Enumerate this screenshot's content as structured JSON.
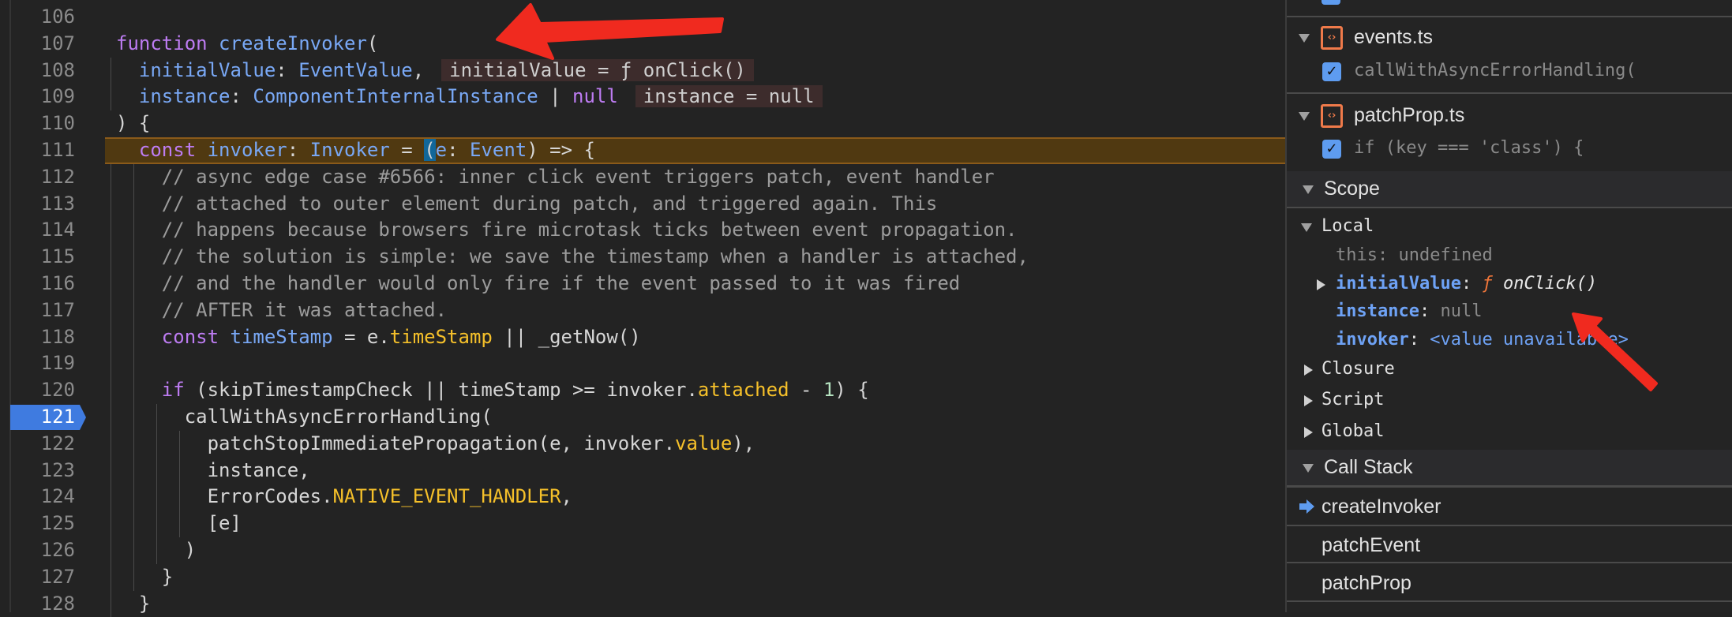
{
  "editor": {
    "execution_line": 111,
    "breakpoint_line": 121,
    "lines": [
      {
        "num": "106",
        "indent": 0,
        "tokens": []
      },
      {
        "num": "107",
        "indent": 0,
        "tokens": [
          {
            "t": "function ",
            "k": "kw"
          },
          {
            "t": "createInvoker",
            "k": "id"
          },
          {
            "t": "(",
            "k": "pl"
          }
        ]
      },
      {
        "num": "108",
        "indent": 2,
        "tokens": [
          {
            "t": "initialValue",
            "k": "id"
          },
          {
            "t": ": ",
            "k": "pl"
          },
          {
            "t": "EventValue",
            "k": "id"
          },
          {
            "t": ",",
            "k": "pl"
          }
        ],
        "inline": "initialValue = ƒ onClick()"
      },
      {
        "num": "109",
        "indent": 2,
        "tokens": [
          {
            "t": "instance",
            "k": "id"
          },
          {
            "t": ": ",
            "k": "pl"
          },
          {
            "t": "ComponentInternalInstance",
            "k": "id"
          },
          {
            "t": " | ",
            "k": "pl"
          },
          {
            "t": "null",
            "k": "kw"
          }
        ],
        "inline": "instance = null"
      },
      {
        "num": "110",
        "indent": 0,
        "tokens": [
          {
            "t": ") {",
            "k": "pl"
          }
        ]
      },
      {
        "num": "111",
        "indent": 2,
        "tokens": [
          {
            "t": "const ",
            "k": "kw"
          },
          {
            "t": "invoker",
            "k": "id"
          },
          {
            "t": ": ",
            "k": "pl"
          },
          {
            "t": "Invoker",
            "k": "id"
          },
          {
            "t": " = ",
            "k": "pl"
          },
          {
            "t": "(",
            "k": "cursor"
          },
          {
            "t": "e",
            "k": "id"
          },
          {
            "t": ": ",
            "k": "pl"
          },
          {
            "t": "Event",
            "k": "id"
          },
          {
            "t": ") => {",
            "k": "pl"
          }
        ]
      },
      {
        "num": "112",
        "indent": 4,
        "tokens": [
          {
            "t": "// async edge case #6566: inner click event triggers patch, event handler",
            "k": "cm"
          }
        ]
      },
      {
        "num": "113",
        "indent": 4,
        "tokens": [
          {
            "t": "// attached to outer element during patch, and triggered again. This",
            "k": "cm"
          }
        ]
      },
      {
        "num": "114",
        "indent": 4,
        "tokens": [
          {
            "t": "// happens because browsers fire microtask ticks between event propagation.",
            "k": "cm"
          }
        ]
      },
      {
        "num": "115",
        "indent": 4,
        "tokens": [
          {
            "t": "// the solution is simple: we save the timestamp when a handler is attached,",
            "k": "cm"
          }
        ]
      },
      {
        "num": "116",
        "indent": 4,
        "tokens": [
          {
            "t": "// and the handler would only fire if the event passed to it was fired",
            "k": "cm"
          }
        ]
      },
      {
        "num": "117",
        "indent": 4,
        "tokens": [
          {
            "t": "// AFTER it was attached.",
            "k": "cm"
          }
        ]
      },
      {
        "num": "118",
        "indent": 4,
        "tokens": [
          {
            "t": "const ",
            "k": "kw"
          },
          {
            "t": "timeStamp",
            "k": "id"
          },
          {
            "t": " = e.",
            "k": "pl"
          },
          {
            "t": "timeStamp",
            "k": "prop"
          },
          {
            "t": " || _getNow()",
            "k": "pl"
          }
        ]
      },
      {
        "num": "119",
        "indent": 4,
        "tokens": []
      },
      {
        "num": "120",
        "indent": 4,
        "tokens": [
          {
            "t": "if ",
            "k": "kw"
          },
          {
            "t": "(skipTimestampCheck || timeStamp >= invoker.",
            "k": "pl"
          },
          {
            "t": "attached",
            "k": "prop"
          },
          {
            "t": " - ",
            "k": "pl"
          },
          {
            "t": "1",
            "k": "num"
          },
          {
            "t": ") {",
            "k": "pl"
          }
        ]
      },
      {
        "num": "121",
        "indent": 6,
        "tokens": [
          {
            "t": "callWithAsyncErrorHandling(",
            "k": "pl"
          }
        ]
      },
      {
        "num": "122",
        "indent": 8,
        "tokens": [
          {
            "t": "patchStopImmediatePropagation(e, invoker.",
            "k": "pl"
          },
          {
            "t": "value",
            "k": "prop"
          },
          {
            "t": "),",
            "k": "pl"
          }
        ]
      },
      {
        "num": "123",
        "indent": 8,
        "tokens": [
          {
            "t": "instance,",
            "k": "pl"
          }
        ]
      },
      {
        "num": "124",
        "indent": 8,
        "tokens": [
          {
            "t": "ErrorCodes.",
            "k": "pl"
          },
          {
            "t": "NATIVE_EVENT_HANDLER",
            "k": "prop"
          },
          {
            "t": ",",
            "k": "pl"
          }
        ]
      },
      {
        "num": "125",
        "indent": 8,
        "tokens": [
          {
            "t": "[e]",
            "k": "pl"
          }
        ]
      },
      {
        "num": "126",
        "indent": 6,
        "tokens": [
          {
            "t": ")",
            "k": "pl"
          }
        ]
      },
      {
        "num": "127",
        "indent": 4,
        "tokens": [
          {
            "t": "}",
            "k": "pl"
          }
        ]
      },
      {
        "num": "128",
        "indent": 2,
        "tokens": [
          {
            "t": "}",
            "k": "pl"
          }
        ]
      }
    ]
  },
  "breakpoints": {
    "files": [
      {
        "name": "events.ts",
        "line_text": "callWithAsyncErrorHandling(",
        "checked": true
      },
      {
        "name": "patchProp.ts",
        "line_text": "if (key === 'class') {",
        "checked": true
      }
    ]
  },
  "scope": {
    "title": "Scope",
    "local_label": "Local",
    "this_key": "this",
    "this_value": "undefined",
    "initial_key": "initialValue",
    "initial_fn": "ƒ",
    "initial_value": "onClick()",
    "instance_key": "instance",
    "instance_value": "null",
    "invoker_key": "invoker",
    "invoker_value": "<value unavailable>",
    "groups": [
      "Closure",
      "Script",
      "Global"
    ]
  },
  "call_stack": {
    "title": "Call Stack",
    "frames": [
      "createInvoker",
      "patchEvent",
      "patchProp"
    ]
  },
  "colors": {
    "accent": "#3f7be0",
    "exec_line": "#503911",
    "file_icon": "#ef7a4a",
    "annotation": "#f02a1f"
  }
}
